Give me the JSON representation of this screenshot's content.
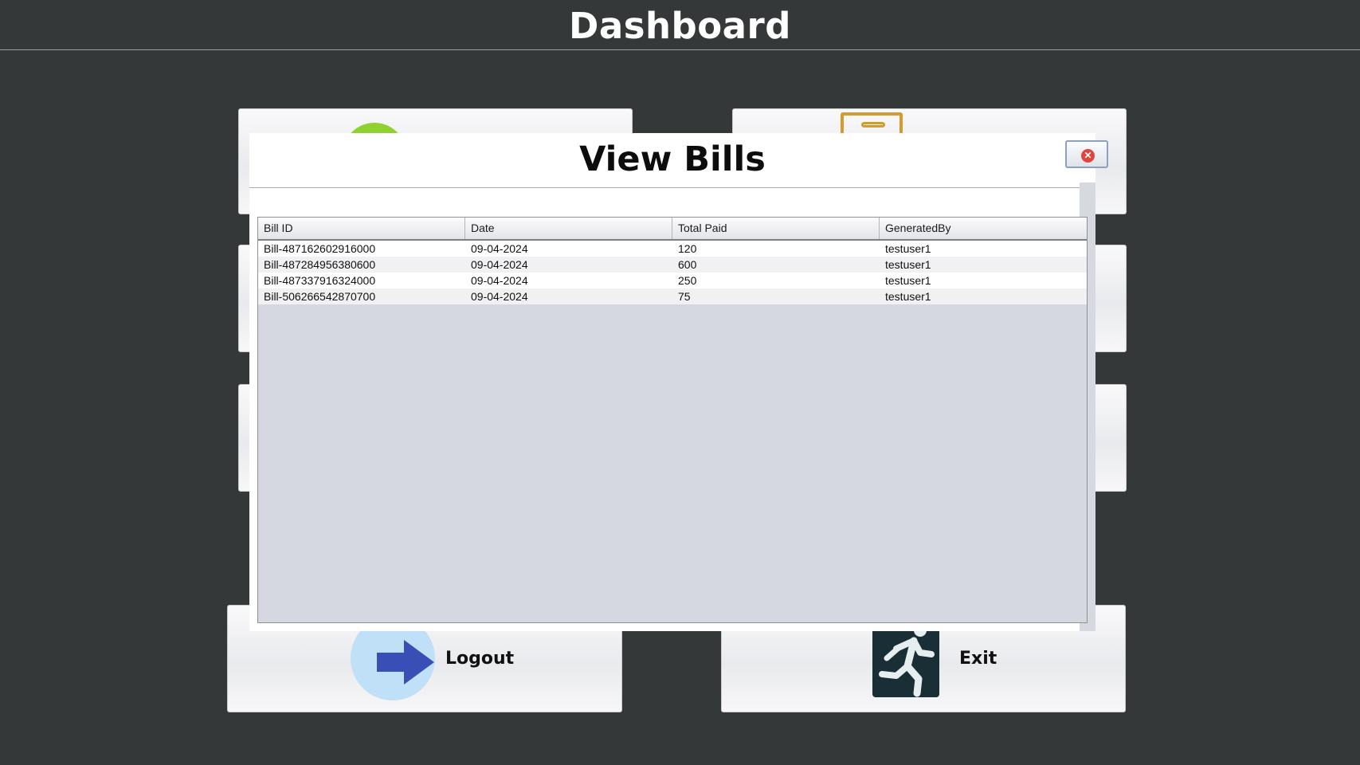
{
  "header": {
    "title": "Dashboard"
  },
  "dialog": {
    "title": "View Bills",
    "close_icon": "close-icon",
    "table": {
      "columns": [
        "Bill ID",
        "Date",
        "Total Paid",
        "GeneratedBy"
      ],
      "rows": [
        [
          "Bill-487162602916000",
          "09-04-2024",
          "120",
          "testuser1"
        ],
        [
          "Bill-487284956380600",
          "09-04-2024",
          "600",
          "testuser1"
        ],
        [
          "Bill-487337916324000",
          "09-04-2024",
          "250",
          "testuser1"
        ],
        [
          "Bill-506266542870700",
          "09-04-2024",
          "75",
          "testuser1"
        ]
      ]
    }
  },
  "tiles": {
    "logout": {
      "label": "Logout",
      "icon": "arrow-right-icon"
    },
    "exit": {
      "label": "Exit",
      "icon": "running-man-icon"
    }
  },
  "colors": {
    "background": "#343839",
    "tile_icon_green": "#8fd12e",
    "tile_icon_orange": "#d79a2c",
    "logout_circle": "#bfe0f7",
    "logout_arrow": "#3a4fb5",
    "exit_icon_bg": "#1a2f35"
  }
}
